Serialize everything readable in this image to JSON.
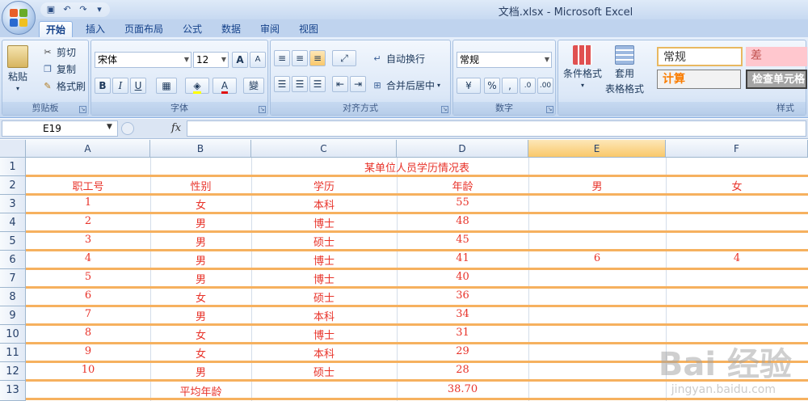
{
  "window": {
    "title": "文档.xlsx - Microsoft Excel"
  },
  "tabs": [
    {
      "label": "开始",
      "active": true
    },
    {
      "label": "插入"
    },
    {
      "label": "页面布局"
    },
    {
      "label": "公式"
    },
    {
      "label": "数据"
    },
    {
      "label": "审阅"
    },
    {
      "label": "视图"
    }
  ],
  "ribbon": {
    "clipboard": {
      "paste": "粘贴",
      "cut": "剪切",
      "copy": "复制",
      "format_painter": "格式刷",
      "label": "剪贴板"
    },
    "font": {
      "name": "宋体",
      "size": "12",
      "bold": "B",
      "italic": "I",
      "underline": "U",
      "label": "字体",
      "wen": "變",
      "grow": "A",
      "shrink": "A",
      "color_a": "A"
    },
    "alignment": {
      "wrap": "自动换行",
      "merge": "合并后居中",
      "label": "对齐方式"
    },
    "number": {
      "format": "常规",
      "percent": "%",
      "comma": ",",
      "label": "数字"
    },
    "styles": {
      "conditional": "条件格式",
      "table_format_1": "套用",
      "table_format_2": "表格格式",
      "style_normal": "常规",
      "style_bad": "差",
      "style_calc": "计算",
      "style_check": "检查单元格",
      "label": "样式"
    }
  },
  "formula_bar": {
    "name_box": "E19",
    "fx": "fx",
    "formula": ""
  },
  "columns": [
    "A",
    "B",
    "C",
    "D",
    "E",
    "F"
  ],
  "rows": [
    "1",
    "2",
    "3",
    "4",
    "5",
    "6",
    "7",
    "8",
    "9",
    "10",
    "11",
    "12",
    "13"
  ],
  "sheet": {
    "title": "某单位人员学历情况表",
    "headers": [
      "职工号",
      "性别",
      "学历",
      "年龄",
      "男",
      "女"
    ],
    "records": [
      [
        "1",
        "女",
        "本科",
        "55",
        "",
        ""
      ],
      [
        "2",
        "男",
        "博士",
        "48",
        "",
        ""
      ],
      [
        "3",
        "男",
        "硕士",
        "45",
        "",
        ""
      ],
      [
        "4",
        "男",
        "博士",
        "41",
        "6",
        "4"
      ],
      [
        "5",
        "男",
        "博士",
        "40",
        "",
        ""
      ],
      [
        "6",
        "女",
        "硕士",
        "36",
        "",
        ""
      ],
      [
        "7",
        "男",
        "本科",
        "34",
        "",
        ""
      ],
      [
        "8",
        "女",
        "博士",
        "31",
        "",
        ""
      ],
      [
        "9",
        "女",
        "本科",
        "29",
        "",
        ""
      ],
      [
        "10",
        "男",
        "硕士",
        "28",
        "",
        ""
      ]
    ],
    "avg_label": "平均年龄",
    "avg_value": "38.70"
  },
  "watermark": {
    "main": "Bai 经验",
    "sub": "jingyan.baidu.com"
  },
  "colors": {
    "cell_text": "#e8332a",
    "row_line": "#f6b15f",
    "selected_col": "#f9c86a"
  }
}
